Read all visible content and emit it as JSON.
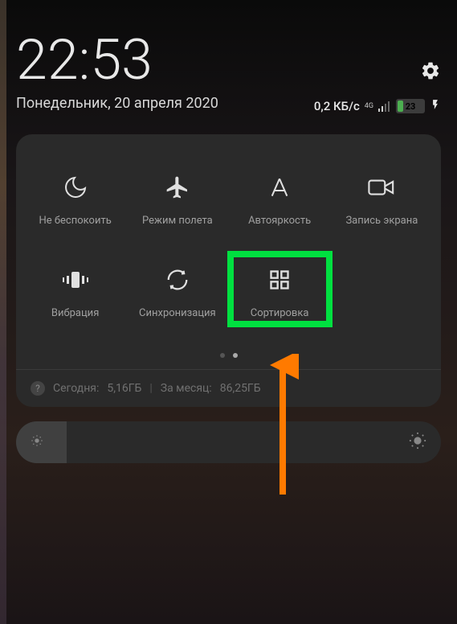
{
  "clock": "22:53",
  "date": "Понедельник, 20 апреля 2020",
  "status": {
    "data_rate": "0,2 КБ/с",
    "net": "4G",
    "battery_percent": "23"
  },
  "tiles": [
    {
      "label": "Не беспокоить",
      "icon": "moon"
    },
    {
      "label": "Режим полета",
      "icon": "airplane"
    },
    {
      "label": "Автояркость",
      "icon": "auto-brightness"
    },
    {
      "label": "Запись экрана",
      "icon": "video"
    },
    {
      "label": "Вибрация",
      "icon": "vibrate"
    },
    {
      "label": "Синхронизация",
      "icon": "sync"
    },
    {
      "label": "Сортировка",
      "icon": "grid",
      "highlighted": true
    }
  ],
  "usage": {
    "today_label": "Сегодня:",
    "today_value": "5,16ГБ",
    "month_label": "За месяц:",
    "month_value": "86,25ГБ"
  }
}
